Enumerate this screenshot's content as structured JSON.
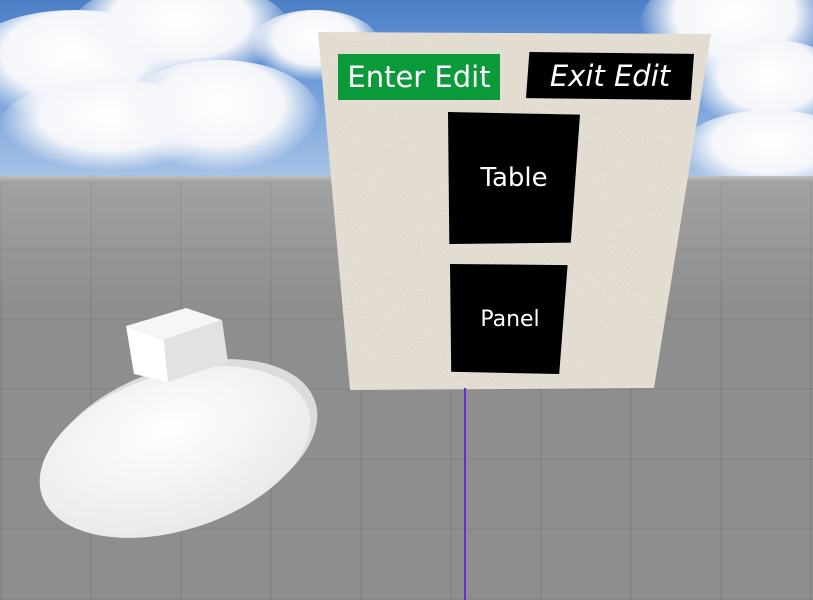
{
  "scene": {
    "sky_color": "#6e9bd8",
    "ground_color": "#8e8e8e",
    "board_texture_color": "#ebe4d6",
    "laser_color": "#6a2bd6",
    "controller_color": "#ffffff"
  },
  "edit_panel": {
    "enter_edit_label": "Enter Edit",
    "enter_edit_color": "#0a9a3a",
    "exit_edit_label": "Exit Edit",
    "exit_edit_color": "#000000",
    "table_label": "Table",
    "panel_label": "Panel"
  }
}
